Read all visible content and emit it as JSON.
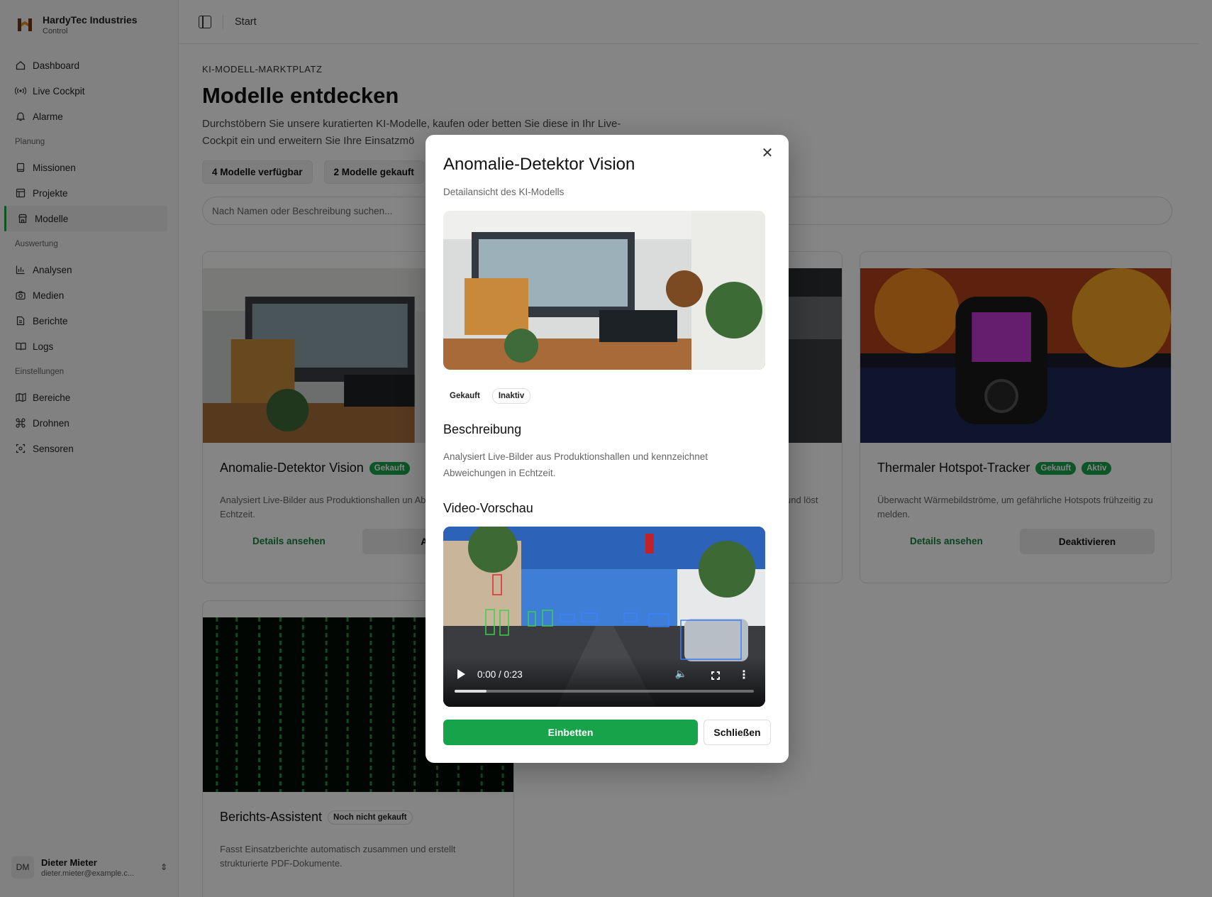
{
  "brand": {
    "name": "HardyTec Industries",
    "sub": "Control"
  },
  "nav": [
    {
      "label": "Dashboard",
      "icon": "home-icon"
    },
    {
      "label": "Live Cockpit",
      "icon": "radio-icon"
    },
    {
      "label": "Alarme",
      "icon": "bell-icon"
    }
  ],
  "sections": {
    "planung": "Planung",
    "auswertung": "Auswertung",
    "einstellungen": "Einstellungen"
  },
  "nav_planung": [
    {
      "label": "Missionen",
      "icon": "book-icon"
    },
    {
      "label": "Projekte",
      "icon": "layout-icon"
    },
    {
      "label": "Modelle",
      "icon": "store-icon",
      "active": true
    }
  ],
  "nav_auswertung": [
    {
      "label": "Analysen",
      "icon": "chart-icon"
    },
    {
      "label": "Medien",
      "icon": "camera-icon"
    },
    {
      "label": "Berichte",
      "icon": "file-icon"
    },
    {
      "label": "Logs",
      "icon": "open-book-icon"
    }
  ],
  "nav_einstellungen": [
    {
      "label": "Bereiche",
      "icon": "map-icon"
    },
    {
      "label": "Drohnen",
      "icon": "drone-icon"
    },
    {
      "label": "Sensoren",
      "icon": "sensor-icon"
    }
  ],
  "user": {
    "initials": "DM",
    "name": "Dieter Mieter",
    "email": "dieter.mieter@example.c..."
  },
  "topbar": {
    "crumb": "Start"
  },
  "page": {
    "eyebrow": "KI-MODELL-MARKTPLATZ",
    "title": "Modelle entdecken",
    "lead": "Durchstöbern Sie unsere kuratierten KI-Modelle, kaufen oder betten Sie diese in Ihr Live-Cockpit ein und erweitern Sie Ihre Einsatzmö",
    "stat1": "4 Modelle verfügbar",
    "stat2": "2 Modelle gekauft",
    "search_placeholder": "Nach Namen oder Beschreibung suchen..."
  },
  "cards": {
    "c1": {
      "title": "Anomalie-Detektor Vision",
      "badge": "Gekauft",
      "desc": "Analysiert Live-Bilder aus Produktionshallen un Abweichungen in Echtzeit.",
      "link": "Details ansehen",
      "btn": "Akti"
    },
    "c2": {
      "desc": "und löst"
    },
    "c3": {
      "title": "Thermaler Hotspot-Tracker",
      "badge1": "Gekauft",
      "badge2": "Aktiv",
      "desc": "Überwacht Wärmebildströme, um gefährliche Hotspots frühzeitig zu melden.",
      "link": "Details ansehen",
      "btn": "Deaktivieren"
    },
    "c4": {
      "title": "Berichts-Assistent",
      "badge": "Noch nicht gekauft",
      "desc": "Fasst Einsatzberichte automatisch zusammen und erstellt strukturierte PDF-Dokumente."
    }
  },
  "modal": {
    "title": "Anomalie-Detektor Vision",
    "subtitle": "Detailansicht des KI-Modells",
    "badge1": "Gekauft",
    "badge2": "Inaktiv",
    "desc_heading": "Beschreibung",
    "desc": "Analysiert Live-Bilder aus Produktionshallen und kennzeichnet Abweichungen in Echtzeit.",
    "video_heading": "Video-Vorschau",
    "video_time": "0:00 / 0:23",
    "video_progress": 0.1,
    "primary": "Einbetten",
    "secondary": "Schließen"
  }
}
